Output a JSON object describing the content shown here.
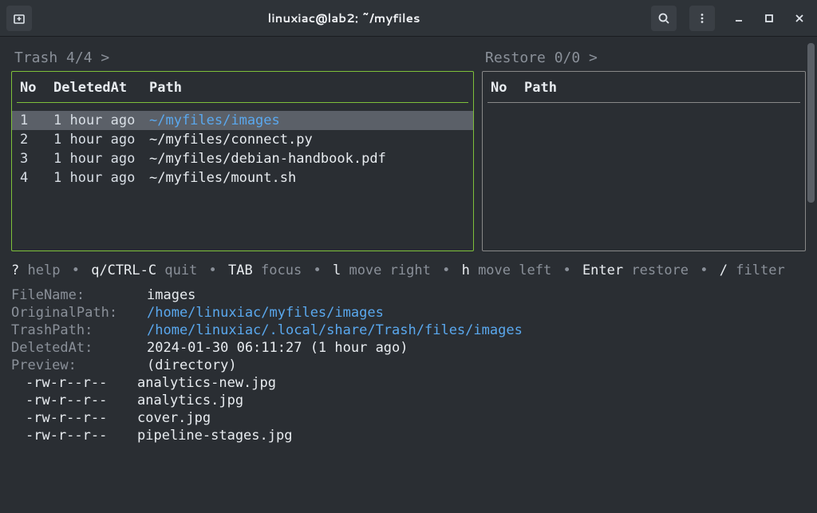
{
  "titlebar": {
    "title": "linuxiac@lab2: ~/myfiles"
  },
  "trash": {
    "header": "Trash 4/4 >",
    "cols": {
      "no": "No",
      "deleted": "DeletedAt",
      "path": "Path"
    },
    "rows": [
      {
        "no": "1",
        "deleted": "1 hour ago",
        "path": "~/myfiles/images"
      },
      {
        "no": "2",
        "deleted": "1 hour ago",
        "path": "~/myfiles/connect.py"
      },
      {
        "no": "3",
        "deleted": "1 hour ago",
        "path": "~/myfiles/debian-handbook.pdf"
      },
      {
        "no": "4",
        "deleted": "1 hour ago",
        "path": "~/myfiles/mount.sh"
      }
    ]
  },
  "restore": {
    "header": "Restore 0/0 >",
    "cols": {
      "no": "No",
      "path": "Path"
    }
  },
  "help": {
    "q": "?",
    "help": "help",
    "quit_k": "q/CTRL-C",
    "quit_l": "quit",
    "tab_k": "TAB",
    "tab_l": "focus",
    "l_k": "l",
    "l_l": "move right",
    "h_k": "h",
    "h_l": "move left",
    "enter_k": "Enter",
    "enter_l": "restore",
    "slash_k": "/",
    "slash_l": "filter",
    "dot": "•"
  },
  "details": {
    "filename_l": "FileName:",
    "filename_v": "images",
    "origpath_l": "OriginalPath:",
    "origpath_v": "/home/linuxiac/myfiles/images",
    "trashpath_l": "TrashPath:",
    "trashpath_v": "/home/linuxiac/.local/share/Trash/files/images",
    "deleted_l": "DeletedAt:",
    "deleted_v": "2024-01-30 06:11:27 (1 hour ago)",
    "preview_l": "Preview:",
    "preview_v": "(directory)"
  },
  "preview_files": [
    {
      "perm": "-rw-r--r--",
      "name": "analytics-new.jpg"
    },
    {
      "perm": "-rw-r--r--",
      "name": "analytics.jpg"
    },
    {
      "perm": "-rw-r--r--",
      "name": "cover.jpg"
    },
    {
      "perm": "-rw-r--r--",
      "name": "pipeline-stages.jpg"
    }
  ]
}
